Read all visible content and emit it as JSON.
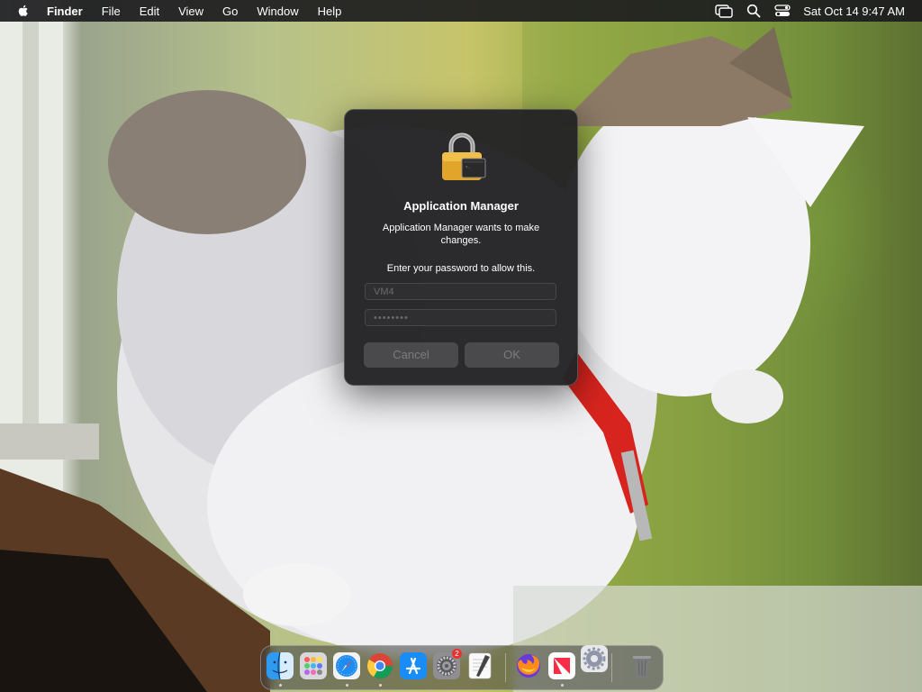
{
  "menubar": {
    "app_name": "Finder",
    "items": [
      "File",
      "Edit",
      "View",
      "Go",
      "Window",
      "Help"
    ],
    "clock": "Sat Oct 14  9:47 AM",
    "status_icons": [
      "screen-mirroring-icon",
      "spotlight-search-icon",
      "control-center-icon"
    ]
  },
  "dialog": {
    "title": "Application Manager",
    "message": "Application Manager wants to make changes.",
    "prompt": "Enter your password to allow this.",
    "username_value": "VM4",
    "password_value": "••••••••",
    "cancel_label": "Cancel",
    "ok_label": "OK",
    "icon": "padlock-terminal-icon"
  },
  "dock": {
    "apps": [
      {
        "name": "Finder",
        "icon": "finder-icon",
        "running": true
      },
      {
        "name": "Launchpad",
        "icon": "launchpad-icon",
        "running": false
      },
      {
        "name": "Safari",
        "icon": "safari-icon",
        "running": true
      },
      {
        "name": "Google Chrome",
        "icon": "chrome-icon",
        "running": true
      },
      {
        "name": "App Store",
        "icon": "app-store-icon",
        "running": false
      },
      {
        "name": "System Settings",
        "icon": "system-settings-icon",
        "running": false,
        "badge": "2"
      },
      {
        "name": "TextEdit",
        "icon": "textedit-icon",
        "running": false
      },
      {
        "name": "Firefox",
        "icon": "firefox-icon",
        "running": false
      },
      {
        "name": "News",
        "icon": "news-icon",
        "running": true
      },
      {
        "name": "Settings (dragging)",
        "icon": "gear-app-icon",
        "running": false
      },
      {
        "name": "Trash",
        "icon": "trash-icon",
        "running": false
      }
    ]
  },
  "colors": {
    "menubar_bg": "#1c1c1e",
    "dialog_bg": "#242426",
    "button_bg": "#4a4a4c",
    "badge": "#e8322f"
  }
}
